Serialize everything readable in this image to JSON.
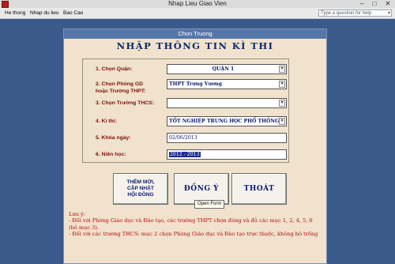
{
  "window": {
    "title": "Nhap Lieu Giao Vien",
    "minimize_glyph": "–",
    "maximize_glyph": "□",
    "close_glyph": "✕"
  },
  "menu": {
    "items": [
      {
        "label": "He thong"
      },
      {
        "label": "Nhap du lieu"
      },
      {
        "label": "Bao Cao"
      }
    ],
    "help_placeholder": "Type a question for help",
    "help_dropdown_glyph": "▾"
  },
  "form": {
    "window_title": "Chon Truong",
    "heading": "NHẬP THÔNG TIN KÌ THI",
    "fields": {
      "quan": {
        "label": "1. Chọn Quận:",
        "value": "QUẬN 1"
      },
      "phong_gd": {
        "label": "2. Chọn Phòng GD\nhoặc Trường THPT:",
        "value": "THPT Trưng Vương"
      },
      "truong_thcs": {
        "label": "3. Chọn Trường THCS:",
        "value": ""
      },
      "ki_thi": {
        "label": "4. Kì thi:",
        "value": "TỐT NGHIỆP TRUNG HỌC PHỔ THÔNG"
      },
      "khoa_ngay": {
        "label": "5. Khóa ngày:",
        "value": "02/06/2013"
      },
      "nien_hoc": {
        "label": "6. Niên học:",
        "value": "2012 - 2013"
      }
    },
    "dropdown_glyph": "▾",
    "buttons": {
      "them_moi": "THÊM MỚI,\nCẬP NHẬT\nHỘI ĐỒNG",
      "dong_y": "ĐỒNG Ý",
      "thoat": "THOÁT"
    },
    "tooltip": "Open Form",
    "notes": {
      "title": "Lưu ý:",
      "line1": "- Đối với Phòng Giáo dục và Đào tạo, các trường THPT chọn đúng và đủ các mục 1, 2, 4, 5, 6 (bỏ mục 3).",
      "line2": "- Đối với các trường THCS: mục 2 chọn Phòng Giáo dục và Đào tạo trực thuộc, không bỏ trống mục"
    }
  }
}
